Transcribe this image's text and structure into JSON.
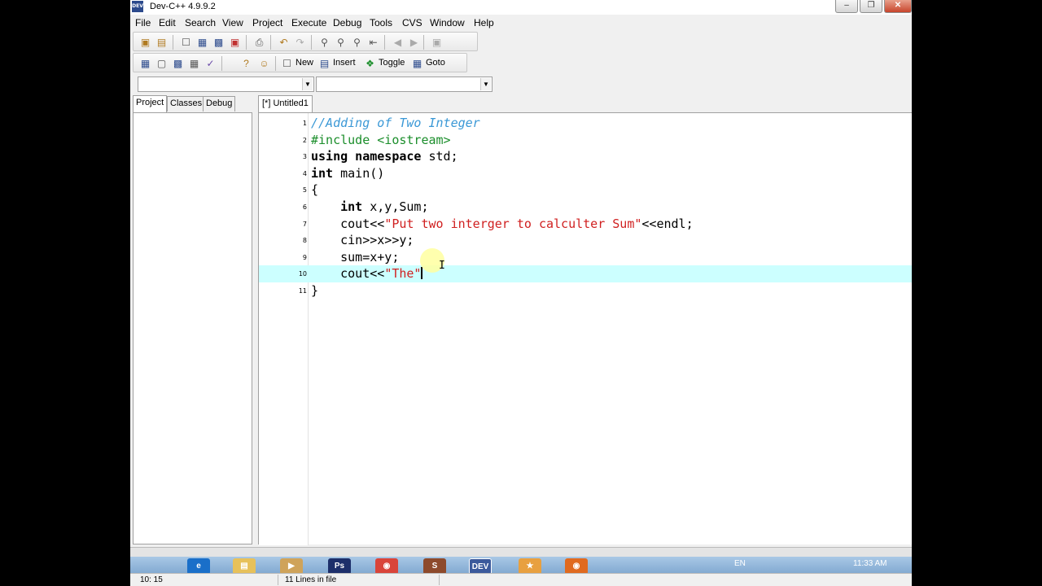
{
  "window": {
    "title": "Dev-C++ 4.9.9.2",
    "app_icon_text": "DEV"
  },
  "menu": [
    "File",
    "Edit",
    "Search",
    "View",
    "Project",
    "Execute",
    "Debug",
    "Tools",
    "CVS",
    "Window",
    "Help"
  ],
  "toolbar2": {
    "new": "New",
    "insert": "Insert",
    "toggle": "Toggle",
    "goto": "Goto"
  },
  "left_tabs": [
    "Project",
    "Classes",
    "Debug"
  ],
  "editor": {
    "tab_label": "[*] Untitled1",
    "lines": [
      {
        "n": "1"
      },
      {
        "n": "2"
      },
      {
        "n": "3"
      },
      {
        "n": "4"
      },
      {
        "n": "5"
      },
      {
        "n": "6"
      },
      {
        "n": "7"
      },
      {
        "n": "8"
      },
      {
        "n": "9"
      },
      {
        "n": "10"
      },
      {
        "n": "11"
      }
    ],
    "code": {
      "l1": "//Adding of Two Integer",
      "l2": "#include <iostream>",
      "l3_kw": "using namespace",
      "l3_rest": " std;",
      "l4_kw": "int",
      "l4_rest": " main()",
      "l5": "{",
      "l6_kw": "int",
      "l6_rest": " x,y,Sum;",
      "l7_a": "    cout<<",
      "l7_str": "\"Put two interger to calculter Sum\"",
      "l7_b": "<<endl;",
      "l8": "    cin>>x>>y;",
      "l9": "    sum=x+y;",
      "l10_a": "    cout<<",
      "l10_str": "\"The\"",
      "l11": "}"
    }
  },
  "status": {
    "position": "10: 15",
    "lines": "11 Lines in file"
  },
  "taskbar": {
    "lang": "EN",
    "time": "11:33 AM"
  },
  "colors": {
    "active_line": "#ccffff",
    "comment": "#3a98d6",
    "string": "#d02020",
    "preprocessor": "#1b8e2b"
  }
}
